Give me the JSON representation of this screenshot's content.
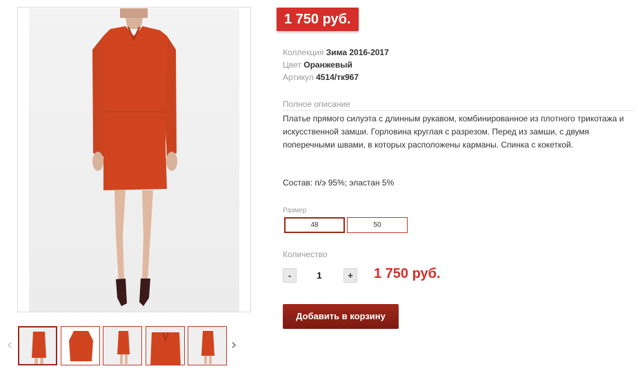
{
  "product": {
    "price_badge": "1 750 руб.",
    "meta": [
      {
        "label": "Коллекция",
        "value": "Зима 2016-2017"
      },
      {
        "label": "Цвет",
        "value": "Оранжевый"
      },
      {
        "label": "Артикул",
        "value": "4514/тк967"
      }
    ],
    "description_title": "Полное описание",
    "description": "Платье прямого силуэта с длинным рукавом, комбинированное из плотного трикотажа и искусственной замши. Горловина круглая с разрезом. Перед из замши, с двумя поперечными швами, в которых расположены карманы. Спинка с кокеткой.",
    "composition": "Состав: п/э 95%; эластан 5%",
    "size_label": "Размер",
    "sizes": [
      "48",
      "50"
    ],
    "selected_size": "48",
    "quantity_label": "Количество",
    "qty_minus": "-",
    "qty_plus": "+",
    "quantity": "1",
    "total_price": "1 750 руб.",
    "add_to_cart": "Добавить в корзину"
  },
  "gallery": {
    "arrow_left": "‹",
    "arrow_right": "›",
    "thumbnail_count": 5,
    "active_thumbnail": 0
  },
  "colors": {
    "accent": "#d42f2a",
    "dress": "#d0451f",
    "button": "#8b2014"
  }
}
